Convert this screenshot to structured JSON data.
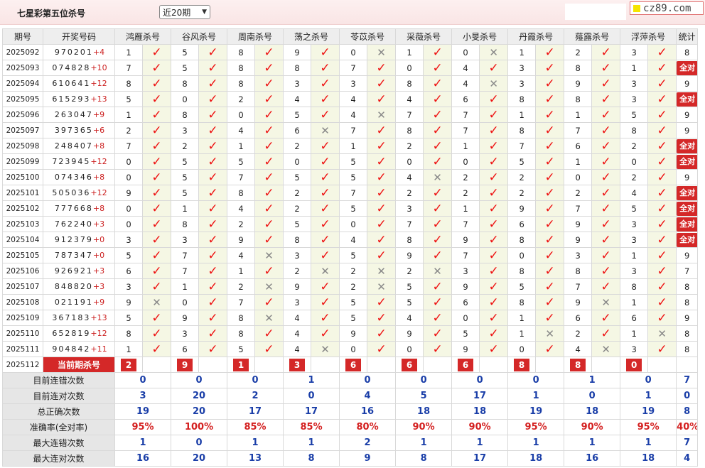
{
  "page_title": "七星彩第五位杀号",
  "period_select": "近20期",
  "logo_text": "cz89.com",
  "headers": {
    "issue": "期号",
    "draw": "开奖号码",
    "stats": "统计"
  },
  "experts": [
    "鸿雁杀号",
    "谷风杀号",
    "周南杀号",
    "荡之杀号",
    "苓苡杀号",
    "采薇杀号",
    "小旻杀号",
    "丹霞杀号",
    "薤露杀号",
    "浮萍杀号"
  ],
  "rows": [
    {
      "issue": "2025092",
      "digits": "970201",
      "plus": "+4",
      "kills": [
        1,
        5,
        8,
        9,
        0,
        1,
        0,
        1,
        2,
        3
      ],
      "ok": [
        1,
        1,
        1,
        1,
        0,
        1,
        0,
        1,
        1,
        1
      ],
      "stat": "8"
    },
    {
      "issue": "2025093",
      "digits": "074828",
      "plus": "+10",
      "kills": [
        7,
        5,
        8,
        8,
        7,
        0,
        4,
        3,
        8,
        1
      ],
      "ok": [
        1,
        1,
        1,
        1,
        1,
        1,
        1,
        1,
        1,
        1
      ],
      "stat": "全对"
    },
    {
      "issue": "2025094",
      "digits": "610641",
      "plus": "+12",
      "kills": [
        8,
        8,
        8,
        3,
        3,
        8,
        4,
        3,
        9,
        3
      ],
      "ok": [
        1,
        1,
        1,
        1,
        1,
        1,
        0,
        1,
        1,
        1
      ],
      "stat": "9"
    },
    {
      "issue": "2025095",
      "digits": "615293",
      "plus": "+13",
      "kills": [
        5,
        0,
        2,
        4,
        4,
        4,
        6,
        8,
        8,
        3
      ],
      "ok": [
        1,
        1,
        1,
        1,
        1,
        1,
        1,
        1,
        1,
        1
      ],
      "stat": "全对"
    },
    {
      "issue": "2025096",
      "digits": "263047",
      "plus": "+9",
      "kills": [
        1,
        8,
        0,
        5,
        4,
        7,
        7,
        1,
        1,
        5
      ],
      "ok": [
        1,
        1,
        1,
        1,
        0,
        1,
        1,
        1,
        1,
        1
      ],
      "stat": "9"
    },
    {
      "issue": "2025097",
      "digits": "397365",
      "plus": "+6",
      "kills": [
        2,
        3,
        4,
        6,
        7,
        8,
        7,
        8,
        7,
        8
      ],
      "ok": [
        1,
        1,
        1,
        0,
        1,
        1,
        1,
        1,
        1,
        1
      ],
      "stat": "9"
    },
    {
      "issue": "2025098",
      "digits": "248407",
      "plus": "+8",
      "kills": [
        7,
        2,
        1,
        2,
        1,
        2,
        1,
        7,
        6,
        2
      ],
      "ok": [
        1,
        1,
        1,
        1,
        1,
        1,
        1,
        1,
        1,
        1
      ],
      "stat": "全对"
    },
    {
      "issue": "2025099",
      "digits": "723945",
      "plus": "+12",
      "kills": [
        0,
        5,
        5,
        0,
        5,
        0,
        0,
        5,
        1,
        0
      ],
      "ok": [
        1,
        1,
        1,
        1,
        1,
        1,
        1,
        1,
        1,
        1
      ],
      "stat": "全对"
    },
    {
      "issue": "2025100",
      "digits": "074346",
      "plus": "+8",
      "kills": [
        0,
        5,
        7,
        5,
        5,
        4,
        2,
        2,
        0,
        2
      ],
      "ok": [
        1,
        1,
        1,
        1,
        1,
        0,
        1,
        1,
        1,
        1
      ],
      "stat": "9"
    },
    {
      "issue": "2025101",
      "digits": "505036",
      "plus": "+12",
      "kills": [
        9,
        5,
        8,
        2,
        7,
        2,
        2,
        2,
        2,
        4
      ],
      "ok": [
        1,
        1,
        1,
        1,
        1,
        1,
        1,
        1,
        1,
        1
      ],
      "stat": "全对"
    },
    {
      "issue": "2025102",
      "digits": "777668",
      "plus": "+8",
      "kills": [
        0,
        1,
        4,
        2,
        5,
        3,
        1,
        9,
        7,
        5
      ],
      "ok": [
        1,
        1,
        1,
        1,
        1,
        1,
        1,
        1,
        1,
        1
      ],
      "stat": "全对"
    },
    {
      "issue": "2025103",
      "digits": "762240",
      "plus": "+3",
      "kills": [
        0,
        8,
        2,
        5,
        0,
        7,
        7,
        6,
        9,
        3
      ],
      "ok": [
        1,
        1,
        1,
        1,
        1,
        1,
        1,
        1,
        1,
        1
      ],
      "stat": "全对"
    },
    {
      "issue": "2025104",
      "digits": "912379",
      "plus": "+0",
      "kills": [
        3,
        3,
        9,
        8,
        4,
        8,
        9,
        8,
        9,
        3
      ],
      "ok": [
        1,
        1,
        1,
        1,
        1,
        1,
        1,
        1,
        1,
        1
      ],
      "stat": "全对"
    },
    {
      "issue": "2025105",
      "digits": "787347",
      "plus": "+0",
      "kills": [
        5,
        7,
        4,
        3,
        5,
        9,
        7,
        0,
        3,
        1
      ],
      "ok": [
        1,
        1,
        0,
        1,
        1,
        1,
        1,
        1,
        1,
        1
      ],
      "stat": "9"
    },
    {
      "issue": "2025106",
      "digits": "926921",
      "plus": "+3",
      "kills": [
        6,
        7,
        1,
        2,
        2,
        2,
        3,
        8,
        8,
        3
      ],
      "ok": [
        1,
        1,
        1,
        0,
        0,
        0,
        1,
        1,
        1,
        1
      ],
      "stat": "7"
    },
    {
      "issue": "2025107",
      "digits": "848820",
      "plus": "+3",
      "kills": [
        3,
        1,
        2,
        9,
        2,
        5,
        9,
        5,
        7,
        8
      ],
      "ok": [
        1,
        1,
        0,
        1,
        0,
        1,
        1,
        1,
        1,
        1
      ],
      "stat": "8"
    },
    {
      "issue": "2025108",
      "digits": "021191",
      "plus": "+9",
      "kills": [
        9,
        0,
        7,
        3,
        5,
        5,
        6,
        8,
        9,
        1
      ],
      "ok": [
        0,
        1,
        1,
        1,
        1,
        1,
        1,
        1,
        0,
        1
      ],
      "stat": "8"
    },
    {
      "issue": "2025109",
      "digits": "367183",
      "plus": "+13",
      "kills": [
        5,
        9,
        8,
        4,
        5,
        4,
        0,
        1,
        6,
        6
      ],
      "ok": [
        1,
        1,
        0,
        1,
        1,
        1,
        1,
        1,
        1,
        1
      ],
      "stat": "9"
    },
    {
      "issue": "2025110",
      "digits": "652819",
      "plus": "+12",
      "kills": [
        8,
        3,
        8,
        4,
        9,
        9,
        5,
        1,
        2,
        1
      ],
      "ok": [
        1,
        1,
        1,
        1,
        1,
        1,
        1,
        0,
        1,
        0
      ],
      "stat": "8"
    },
    {
      "issue": "2025111",
      "digits": "904842",
      "plus": "+11",
      "kills": [
        1,
        6,
        5,
        4,
        0,
        0,
        9,
        0,
        4,
        3
      ],
      "ok": [
        1,
        1,
        1,
        0,
        1,
        1,
        1,
        1,
        0,
        1
      ],
      "stat": "8"
    }
  ],
  "current": {
    "issue": "2025112",
    "label": "当前期杀号",
    "kills": [
      2,
      9,
      1,
      3,
      6,
      6,
      6,
      8,
      8,
      0
    ]
  },
  "stats": [
    {
      "label": "目前连错次数",
      "values": [
        "0",
        "0",
        "0",
        "1",
        "0",
        "0",
        "0",
        "0",
        "1",
        "0"
      ],
      "total": "7",
      "red": false
    },
    {
      "label": "目前连对次数",
      "values": [
        "3",
        "20",
        "2",
        "0",
        "4",
        "5",
        "17",
        "1",
        "0",
        "1"
      ],
      "total": "0",
      "red": false
    },
    {
      "label": "总正确次数",
      "values": [
        "19",
        "20",
        "17",
        "17",
        "16",
        "18",
        "18",
        "19",
        "18",
        "19"
      ],
      "total": "8",
      "red": false
    },
    {
      "label": "准确率(全对率)",
      "values": [
        "95%",
        "100%",
        "85%",
        "85%",
        "80%",
        "90%",
        "90%",
        "95%",
        "90%",
        "95%"
      ],
      "total": "40%",
      "red": true
    },
    {
      "label": "最大连错次数",
      "values": [
        "1",
        "0",
        "1",
        "1",
        "2",
        "1",
        "1",
        "1",
        "1",
        "1"
      ],
      "total": "7",
      "red": false
    },
    {
      "label": "最大连对次数",
      "values": [
        "16",
        "20",
        "13",
        "8",
        "9",
        "8",
        "17",
        "18",
        "16",
        "18"
      ],
      "total": "4",
      "red": false
    }
  ],
  "marks": {
    "correct": "check-icon",
    "wrong": "cross-icon"
  },
  "colors": {
    "accent_red": "#d42828",
    "value_blue": "#1a3ea8",
    "mark_bg": "#f5f7e4"
  }
}
